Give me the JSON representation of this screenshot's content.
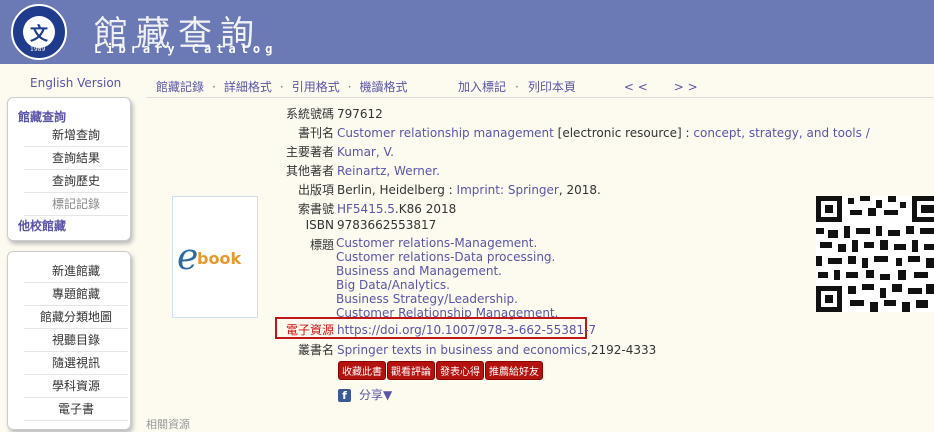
{
  "header": {
    "title_zh": "館藏查詢",
    "title_en": "Library Catalog",
    "logo_year": "1989",
    "logo_colors": {
      "navy": "#1f3c8c",
      "header_bg": "#6b79b4"
    }
  },
  "sidebar": {
    "english_version": "English Version",
    "box1": {
      "head": "館藏查詢",
      "items": [
        "新增查詢",
        "查詢結果",
        "查詢歷史",
        "標記記錄"
      ],
      "footer": "他校館藏"
    },
    "box2": {
      "items": [
        "新進館藏",
        "專題館藏",
        "館藏分類地圖",
        "視聽目錄",
        "隨選視訊",
        "學科資源",
        "電子書"
      ]
    }
  },
  "toolbar": {
    "items": [
      "館藏記錄",
      "詳細格式",
      "引用格式",
      "機讀格式"
    ],
    "sep": "·",
    "add_tag": "加入標記",
    "print": "列印本頁",
    "prev": "< <",
    "next": "> >"
  },
  "record": {
    "sysno_label": "系統號碼",
    "sysno": "797612",
    "title_label": "書刊名",
    "title_link": "Customer relationship management",
    "title_mid": " [electronic resource] : ",
    "title_rest": "concept, strategy, and tools /",
    "author_label": "主要著者",
    "author": "Kumar, V.",
    "other_label": "其他著者",
    "other": "Reinartz, Werner.",
    "pub_label": "出版項",
    "pub_pre": "Berlin, Heidelberg : ",
    "pub_link": "Imprint: Springer",
    "pub_post": ", 2018.",
    "call_label": "索書號",
    "call_link": "HF5415.5",
    "call_rest": ".K86 2018",
    "isbn_label": "ISBN",
    "isbn": "9783662553817",
    "subject_label": "標題",
    "subjects": [
      "Customer relations-Management.",
      "Customer relations-Data processing.",
      "Business and Management.",
      "Big Data/Analytics.",
      "Business Strategy/Leadership.",
      "Customer Relationship Management."
    ],
    "eres_label": "電子資源",
    "eres": "https://doi.org/10.1007/978-3-662-55381-7",
    "series_label": "叢書名",
    "series_link": "Springer texts in business and economics",
    "series_rest": ",2192-4333",
    "ebook_e": "e",
    "ebook_txt": "book"
  },
  "actions": {
    "buttons": [
      "收藏此書",
      "觀看評論",
      "發表心得",
      "推薦給好友"
    ],
    "share": "分享▼",
    "fb": "f"
  },
  "bottom": {
    "partial": "相關資源"
  },
  "colors": {
    "link": "#5a55a8",
    "red_button": "#b4120e",
    "highlight": "#c01616"
  }
}
